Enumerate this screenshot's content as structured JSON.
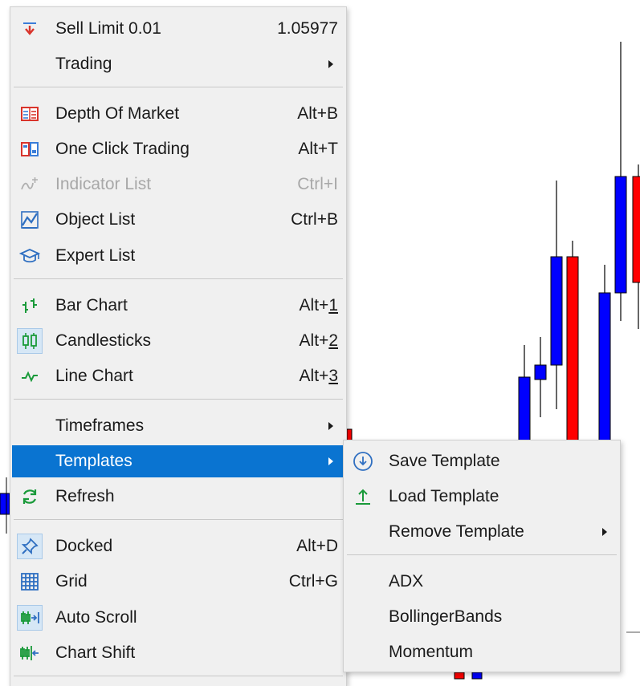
{
  "chart_bars": [
    {
      "color": "blue",
      "high": 380,
      "open": 455,
      "close": 500,
      "low": 455
    },
    {
      "color": "blue",
      "high": 420,
      "open": 360,
      "close": 380,
      "low": 400
    },
    {
      "color": "blue",
      "high": 225,
      "open": 320,
      "close": 350,
      "low": 320
    },
    {
      "color": "red",
      "high": 300,
      "open": 320,
      "close": 310,
      "low": 330
    },
    {
      "color": "blue",
      "high": 330,
      "open": 365,
      "close": 395,
      "low": 365
    },
    {
      "color": "blue",
      "high": 50,
      "open": 220,
      "close": 345,
      "low": 220
    },
    {
      "color": "red",
      "high": 205,
      "open": 220,
      "close": 335,
      "low": 215
    }
  ],
  "colors": {
    "bull": "#0000ff",
    "bear": "#ff0000",
    "hover": "#0a74d1",
    "annotation": "#e01020"
  },
  "main_menu": {
    "sell_limit": {
      "label": "Sell Limit 0.01",
      "value": "1.05977",
      "icon": "sell-limit-icon"
    },
    "trading": {
      "label": "Trading"
    },
    "depth_of_market": {
      "label": "Depth Of Market",
      "shortcut": "Alt+B",
      "icon": "depth-of-market-icon"
    },
    "one_click_trading": {
      "label": "One Click Trading",
      "shortcut": "Alt+T",
      "icon": "one-click-trading-icon"
    },
    "indicator_list": {
      "label": "Indicator List",
      "shortcut": "Ctrl+I",
      "icon": "indicator-list-icon"
    },
    "object_list": {
      "label": "Object List",
      "shortcut": "Ctrl+B",
      "icon": "object-list-icon"
    },
    "expert_list": {
      "label": "Expert List",
      "icon": "expert-list-icon"
    },
    "bar_chart": {
      "label": "Bar Chart",
      "shortcut_prefix": "Alt+",
      "shortcut_key": "1",
      "icon": "bar-chart-icon"
    },
    "candlesticks": {
      "label": "Candlesticks",
      "shortcut_prefix": "Alt+",
      "shortcut_key": "2",
      "icon": "candlesticks-icon"
    },
    "line_chart": {
      "label": "Line Chart",
      "shortcut_prefix": "Alt+",
      "shortcut_key": "3",
      "icon": "line-chart-icon"
    },
    "timeframes": {
      "label": "Timeframes"
    },
    "templates": {
      "label": "Templates"
    },
    "refresh": {
      "label": "Refresh",
      "icon": "refresh-icon"
    },
    "docked": {
      "label": "Docked",
      "shortcut": "Alt+D",
      "icon": "docked-icon"
    },
    "grid": {
      "label": "Grid",
      "shortcut": "Ctrl+G",
      "icon": "grid-icon"
    },
    "auto_scroll": {
      "label": "Auto Scroll",
      "icon": "auto-scroll-icon"
    },
    "chart_shift": {
      "label": "Chart Shift",
      "icon": "chart-shift-icon"
    }
  },
  "templates_submenu": {
    "save_template": {
      "label": "Save Template",
      "icon": "save-template-icon"
    },
    "load_template": {
      "label": "Load Template",
      "icon": "load-template-icon"
    },
    "remove_template": {
      "label": "Remove Template"
    },
    "items": [
      "ADX",
      "BollingerBands",
      "Momentum"
    ]
  }
}
